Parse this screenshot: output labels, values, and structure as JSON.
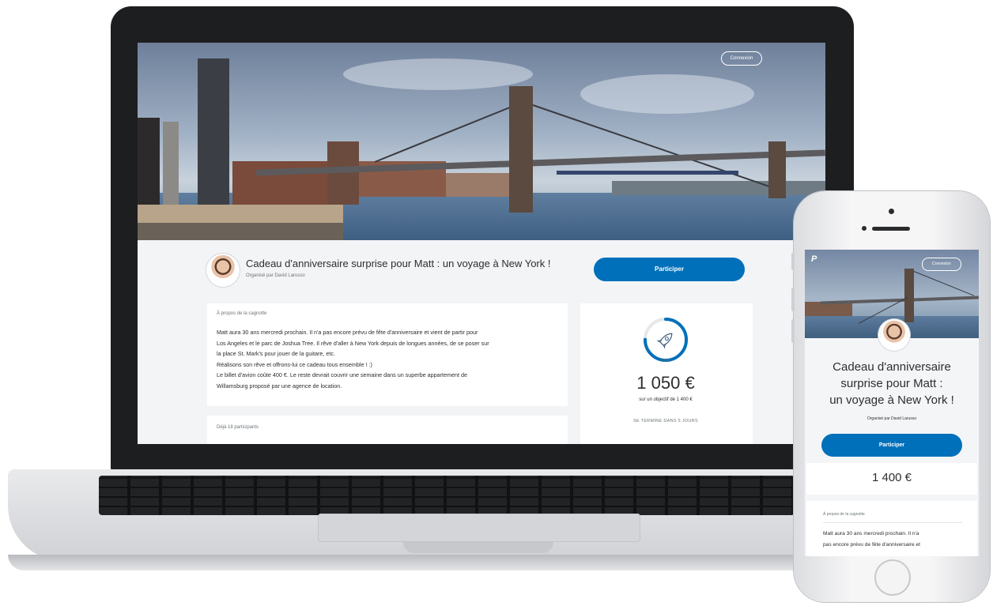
{
  "laptop": {
    "header": {
      "login_label": "Connexion"
    },
    "campaign": {
      "title": "Cadeau d'anniversaire surprise pour Matt : un voyage à New York !",
      "organizer": "Organisé par David Larusso",
      "participate_label": "Participer"
    },
    "about": {
      "heading": "À propos de la cagnotte",
      "lines": [
        "Matt aura 30 ans mercredi prochain. Il n'a pas encore prévu de fête d'anniversaire et vient de partir pour",
        "Los Angeles et le parc de Joshua Tree. Il rêve d'aller à New York depuis de longues années, de se poser sur",
        "la place St. Mark's pour jouer de la guitare, etc.",
        "Réalisons son rêve et offrons-lui ce cadeau tous ensemble ! :)",
        "Le billet d'avion coûte 400 €. Le reste devrait couvrir une semaine dans un superbe appartement de",
        "Willamsburg proposé par une agence de location."
      ]
    },
    "participants": {
      "label": "Déjà 18 participants"
    },
    "progress": {
      "percent_label": "75%",
      "percent_value": 0.75,
      "amount": "1 050 €",
      "goal": "sur un objectif de 1 400 €",
      "ends": "SE TERMINE DANS 5 JOURS",
      "icon": "rocket-icon"
    }
  },
  "phone": {
    "header": {
      "login_label": "Connexion",
      "logo": "P"
    },
    "campaign": {
      "title_lines": [
        "Cadeau d'anniversaire",
        "surprise pour Matt :",
        "un voyage à New York !"
      ],
      "organizer": "Organisé par David Larusso",
      "participate_label": "Participer",
      "amount": "1 400 €"
    },
    "about": {
      "heading": "À propos de la cagnotte",
      "lines": [
        "Matt aura 30 ans mercredi prochain. Il n'a",
        "pas encore prévu de fête d'anniversaire et"
      ]
    }
  },
  "colors": {
    "accent": "#0070ba",
    "text": "#2c2e2f",
    "muted": "#6c7378",
    "background": "#f3f4f6"
  }
}
